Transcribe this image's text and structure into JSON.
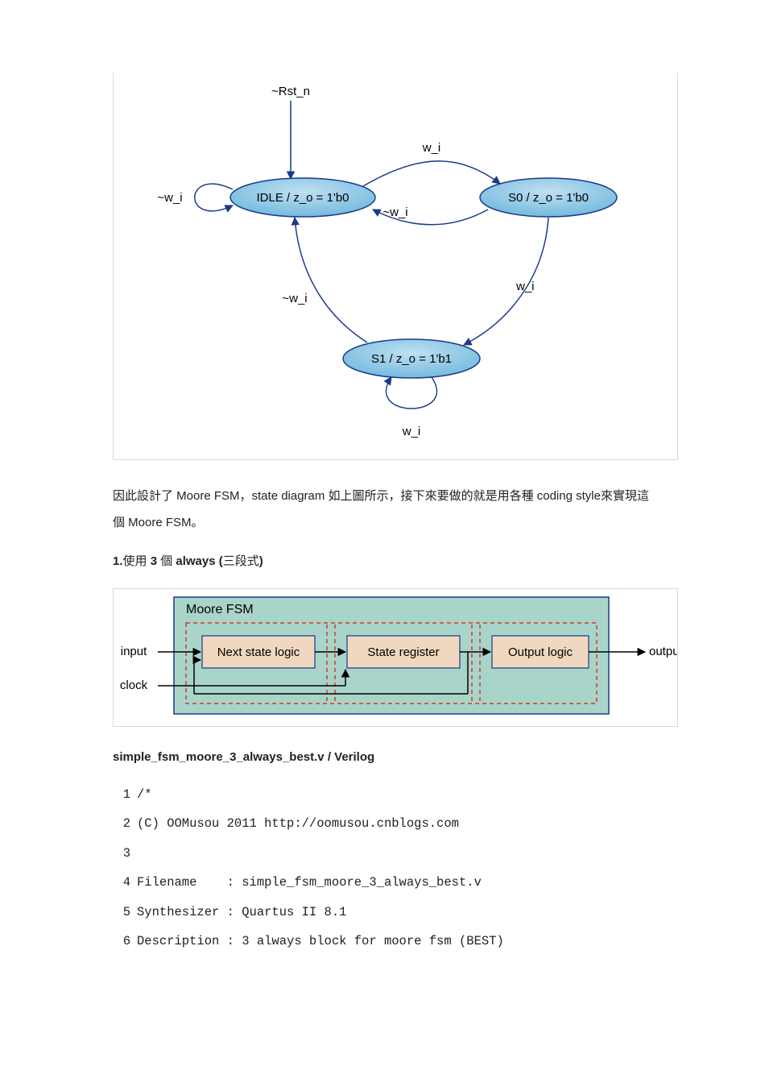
{
  "state_diagram": {
    "reset_label": "~Rst_n",
    "states": {
      "idle": "IDLE / z_o = 1'b0",
      "s0": "S0 / z_o = 1'b0",
      "s1": "S1 / z_o = 1'b1"
    },
    "edges": {
      "idle_self": "~w_i",
      "idle_to_s0": "w_i",
      "s0_to_idle": "~w_i",
      "s0_to_s1": "w_i",
      "s1_to_idle": "~w_i",
      "s1_self": "w_i"
    }
  },
  "paragraph": "因此設計了 Moore FSM，state diagram 如上圖所示，接下來要做的就是用各種 coding style來實現這個 Moore FSM。",
  "heading": {
    "prefix_bold": "1.",
    "mid_plain": "使用 ",
    "three_bold": "3",
    "mid2_plain": " 個 ",
    "always_bold": "always (",
    "sanduan_plain": "三段式",
    "close_bold": ")"
  },
  "block_diagram": {
    "title": "Moore FSM",
    "left_top": "input",
    "left_bottom": "clock",
    "box1": "Next state logic",
    "box2": "State register",
    "box3": "Output logic",
    "right": "output"
  },
  "filename_heading": "simple_fsm_moore_3_always_best.v / Verilog",
  "code": [
    {
      "n": "1",
      "t": "/*"
    },
    {
      "n": "2",
      "t": "(C) OOMusou 2011 http://oomusou.cnblogs.com"
    },
    {
      "n": "3",
      "t": ""
    },
    {
      "n": "4",
      "t": "Filename    : simple_fsm_moore_3_always_best.v"
    },
    {
      "n": "5",
      "t": "Synthesizer : Quartus II 8.1"
    },
    {
      "n": "6",
      "t": "Description : 3 always block for moore fsm (BEST)"
    }
  ]
}
